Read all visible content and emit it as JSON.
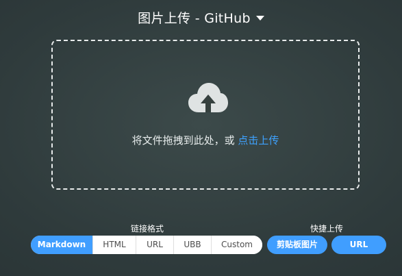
{
  "header": {
    "title": "图片上传 - GitHub",
    "dropdown_icon": "caret-down-icon"
  },
  "dropzone": {
    "icon": "cloud-upload-icon",
    "text": "将文件拖拽到此处，或 ",
    "link": "点击上传"
  },
  "link_format": {
    "label": "链接格式",
    "options": [
      "Markdown",
      "HTML",
      "URL",
      "UBB",
      "Custom"
    ],
    "selected": "Markdown"
  },
  "quick_upload": {
    "label": "快捷上传",
    "clipboard_button": "剪贴板图片",
    "url_button": "URL"
  },
  "colors": {
    "accent": "#409eff",
    "link": "#3ea2ff",
    "background": "#2f3b3c"
  }
}
